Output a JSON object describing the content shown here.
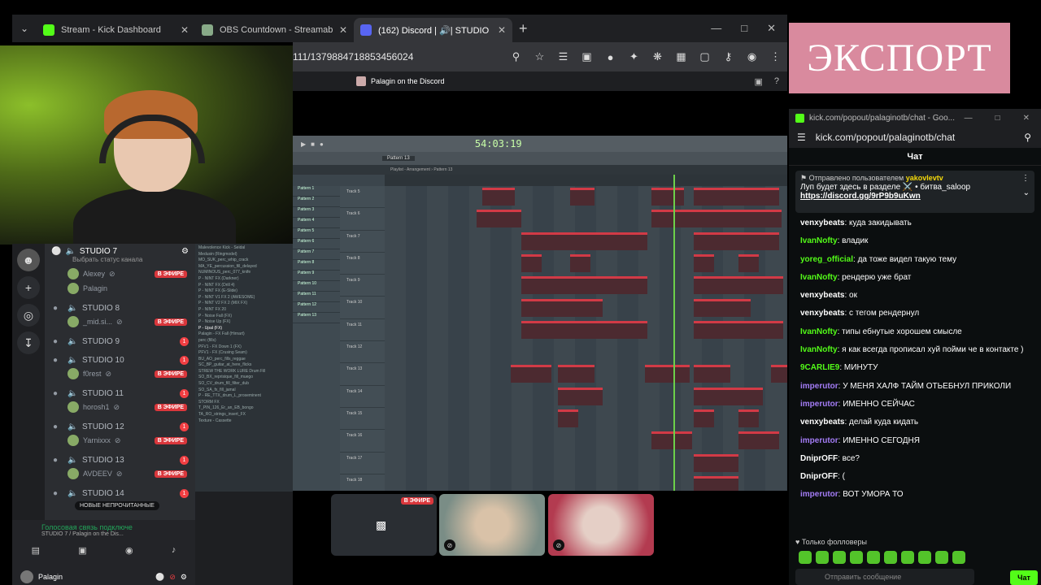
{
  "browser": {
    "tabs": [
      {
        "title": "Stream - Kick Dashboard",
        "fav_color": "#53fc18"
      },
      {
        "title": "OBS Countdown - Streamable Cou",
        "fav_color": "#8a8"
      },
      {
        "title": "(162) Discord | 🔊| STUDIO 7",
        "fav_color": "#5865f2"
      }
    ],
    "url": "111/1379884718853456024",
    "discord_title": "Palagin on the Discord"
  },
  "discord": {
    "server_channel": "STUDIO 7",
    "status_prompt": "Выбрать статус канала",
    "live_label": "В ЭФИРЕ",
    "new_unread": "НОВЫЕ НЕПРОЧИТАННЫЕ",
    "voice_status": "Голосовая связь подключе",
    "voice_sub": "STUDIO 7 / Palagin on the Dis...",
    "username": "Palagin",
    "channels": [
      {
        "name": "STUDIO 7",
        "users": [
          {
            "name": "Alexey",
            "live": true
          },
          {
            "name": "Palagin",
            "live": false
          }
        ]
      },
      {
        "name": "STUDIO 8",
        "users": [
          {
            "name": "_mid.si...",
            "live": true
          }
        ]
      },
      {
        "name": "STUDIO 9",
        "badge": "1",
        "users": []
      },
      {
        "name": "STUDIO 10",
        "badge": "1",
        "users": [
          {
            "name": "f0rest",
            "live": true
          }
        ]
      },
      {
        "name": "STUDIO 11",
        "badge": "1",
        "users": [
          {
            "name": "horosh1",
            "live": true
          }
        ]
      },
      {
        "name": "STUDIO 12",
        "badge": "1",
        "users": [
          {
            "name": "Yarnixxx",
            "live": true
          }
        ]
      },
      {
        "name": "STUDIO 13",
        "badge": "1",
        "users": [
          {
            "name": "AVDEEV",
            "live": true
          }
        ]
      },
      {
        "name": "STUDIO 14",
        "badge": "1",
        "users": []
      }
    ]
  },
  "fl": {
    "time": "54:03:19",
    "pattern": "Pattern 13",
    "playlist_title": "Playlist - Arrangement › Pattern 13",
    "patterns": [
      "Pattern 1",
      "Pattern 2",
      "Pattern 3",
      "Pattern 4",
      "Pattern 5",
      "Pattern 6",
      "Pattern 7",
      "Pattern 8",
      "Pattern 9",
      "Pattern 10",
      "Pattern 11",
      "Pattern 12",
      "Pattern 13"
    ],
    "tracks": [
      "Track 5",
      "Track 6",
      "Track 7",
      "Track 8",
      "Track 9",
      "Track 10",
      "Track 11",
      "Track 12",
      "Track 13",
      "Track 14",
      "Track 15",
      "Track 16",
      "Track 17",
      "Track 18"
    ],
    "browser_items": [
      "Malevolence Kick - Seidal",
      "Medusin (Ringmodel)",
      "MO_SUK_perc_whip_crack",
      "MA_YE_percussion_fill_delayed",
      "NUMINOUS_perc_077_knife",
      "P - NINT FX (Darkner)",
      "P - NINT FX (Drill 4)",
      "P - NINT FX (E-Slide)",
      "P - NINT V1 FX 2 (AWESOME)",
      "P - NINT V2 FX 2 (MIX FX)",
      "P - NINT FX 20",
      "P - Noise Fall (FX)",
      "P - Noise Up (FX)",
      "P - Upal (FX)",
      "Palagin - FX Fall (Hirnart)",
      "perc (fills)",
      "PFV1 - FX Down 1 (FX)",
      "PFV1 - FX (Crusing Seam)",
      "BU_AO_perc_fills_reggae",
      "SC_BP_guitar_at_here_flicks",
      "STREW THE WORK LURE Drum Fill",
      "SO_BX_reprisique_fill_muego",
      "SO_CV_drum_fill_filter_dub",
      "SO_SA_fx_fill_jamal",
      "P - RE_TTX_drum_L_proseminent",
      "STORM FX",
      "T_PIN_126_Er_an_EB_bongo",
      "TA_RO_strings_insert_FX",
      "Texture - Cassette"
    ]
  },
  "export_banner": "ЭКСПОРТ",
  "kick": {
    "window_title": "kick.com/popout/palaginotb/chat - Goo...",
    "url": "kick.com/popout/palaginotb/chat",
    "header": "Чат",
    "pinned_by": "Отправлено пользователем",
    "pinned_user": "yakovlevtv",
    "pinned_text": "Луп будет здесь в разделе ⚔️ • битва_saloop",
    "pinned_link": "https://discord.gg/9rP9b9uKwn",
    "followers_only": "Только фолловеры",
    "input_placeholder": "Отправить сообщение",
    "send_label": "Чат",
    "messages": [
      {
        "user": "venxybeats",
        "color": "#fff",
        "text": "куда закидывать"
      },
      {
        "user": "IvanNofty",
        "color": "#53fc18",
        "text": "владик"
      },
      {
        "user": "yoreg_official",
        "color": "#53fc18",
        "text": "да тоже видел такую тему"
      },
      {
        "user": "IvanNofty",
        "color": "#53fc18",
        "text": "рендерю уже брат"
      },
      {
        "user": "venxybeats",
        "color": "#fff",
        "text": "ок"
      },
      {
        "user": "venxybeats",
        "color": "#fff",
        "text": "с тегом рендернул"
      },
      {
        "user": "IvanNofty",
        "color": "#53fc18",
        "text": "типы ебнутые хорошем смысле"
      },
      {
        "user": "IvanNofty",
        "color": "#53fc18",
        "text": "я как всегда прописал хуй пойми че в контакте )"
      },
      {
        "user": "9CARLIE9",
        "color": "#53fc18",
        "text": "МИНУТУ"
      },
      {
        "user": "imperutor",
        "color": "#a37cf5",
        "text": "У МЕНЯ ХАЛФ ТАЙМ ОТЬЕБНУЛ ПРИКОЛИ"
      },
      {
        "user": "imperutor",
        "color": "#a37cf5",
        "text": "ИМЕННО СЕЙЧАС"
      },
      {
        "user": "venxybeats",
        "color": "#fff",
        "text": "делай куда кидать"
      },
      {
        "user": "imperutor",
        "color": "#a37cf5",
        "text": "ИМЕННО СЕГОДНЯ"
      },
      {
        "user": "DniprOFF",
        "color": "#fff",
        "text": "все?"
      },
      {
        "user": "DniprOFF",
        "color": "#fff",
        "text": "("
      },
      {
        "user": "imperutor",
        "color": "#a37cf5",
        "text": "ВОТ УМОРА ТО"
      }
    ]
  }
}
